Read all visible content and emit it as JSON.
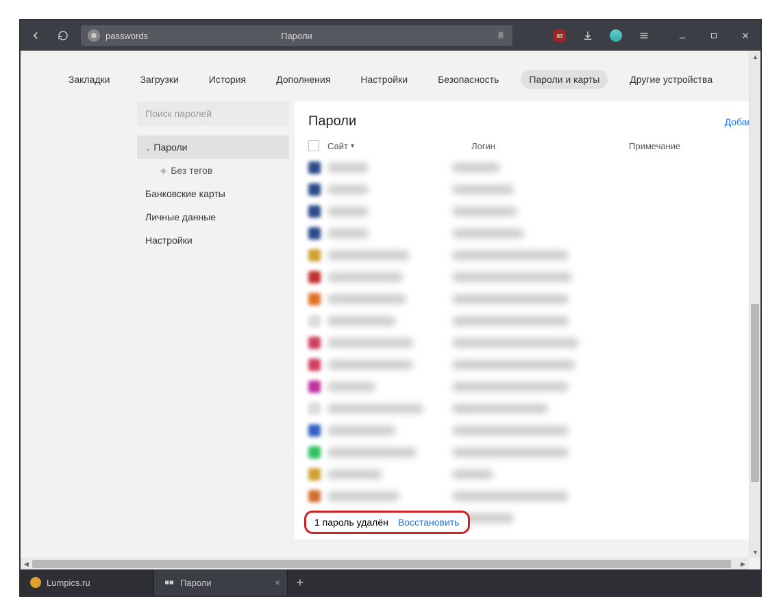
{
  "toolbar": {
    "address_text": "passwords",
    "address_title": "Пароли"
  },
  "nav": {
    "items": [
      "Закладки",
      "Загрузки",
      "История",
      "Дополнения",
      "Настройки",
      "Безопасность",
      "Пароли и карты",
      "Другие устройства"
    ],
    "active_index": 6
  },
  "sidebar": {
    "search_placeholder": "Поиск паролей",
    "items": [
      {
        "label": "Пароли",
        "selected": true,
        "caret": true
      },
      {
        "label": "Без тегов",
        "sub": true
      },
      {
        "label": "Банковские карты"
      },
      {
        "label": "Личные данные"
      },
      {
        "label": "Настройки"
      }
    ]
  },
  "panel": {
    "title": "Пароли",
    "add_label": "Добав",
    "columns": {
      "site": "Сайт",
      "login": "Логин",
      "note": "Примечание"
    },
    "rows": [
      {
        "fav": "#2a4a8a",
        "sw": 60,
        "lw": 70
      },
      {
        "fav": "#2a4a8a",
        "sw": 60,
        "lw": 90
      },
      {
        "fav": "#2a4a8a",
        "sw": 60,
        "lw": 95
      },
      {
        "fav": "#2a4a8a",
        "sw": 60,
        "lw": 105
      },
      {
        "fav": "#d0a030",
        "sw": 120,
        "lw": 170
      },
      {
        "fav": "#c03030",
        "sw": 110,
        "lw": 175
      },
      {
        "fav": "#e07020",
        "sw": 115,
        "lw": 170
      },
      {
        "fav": "#dddddd",
        "sw": 100,
        "lw": 170
      },
      {
        "fav": "#d04060",
        "sw": 125,
        "lw": 185
      },
      {
        "fav": "#d04060",
        "sw": 125,
        "lw": 180
      },
      {
        "fav": "#c030a0",
        "sw": 70,
        "lw": 170
      },
      {
        "fav": "#dddddd",
        "sw": 140,
        "lw": 140
      },
      {
        "fav": "#3060c0",
        "sw": 100,
        "lw": 170
      },
      {
        "fav": "#30c060",
        "sw": 130,
        "lw": 170
      },
      {
        "fav": "#d0a030",
        "sw": 80,
        "lw": 60
      },
      {
        "fav": "#d07030",
        "sw": 105,
        "lw": 170
      },
      {
        "fav": "#dddddd",
        "sw": 90,
        "lw": 90
      }
    ],
    "notice_text": "1 пароль удалён",
    "restore_label": "Восстановить"
  },
  "tabs": {
    "items": [
      {
        "label": "Lumpics.ru",
        "icon_color": "#e0a030",
        "active": false
      },
      {
        "label": "Пароли",
        "icon_color": "#888",
        "active": true,
        "closable": true,
        "pw_icon": true
      }
    ]
  }
}
